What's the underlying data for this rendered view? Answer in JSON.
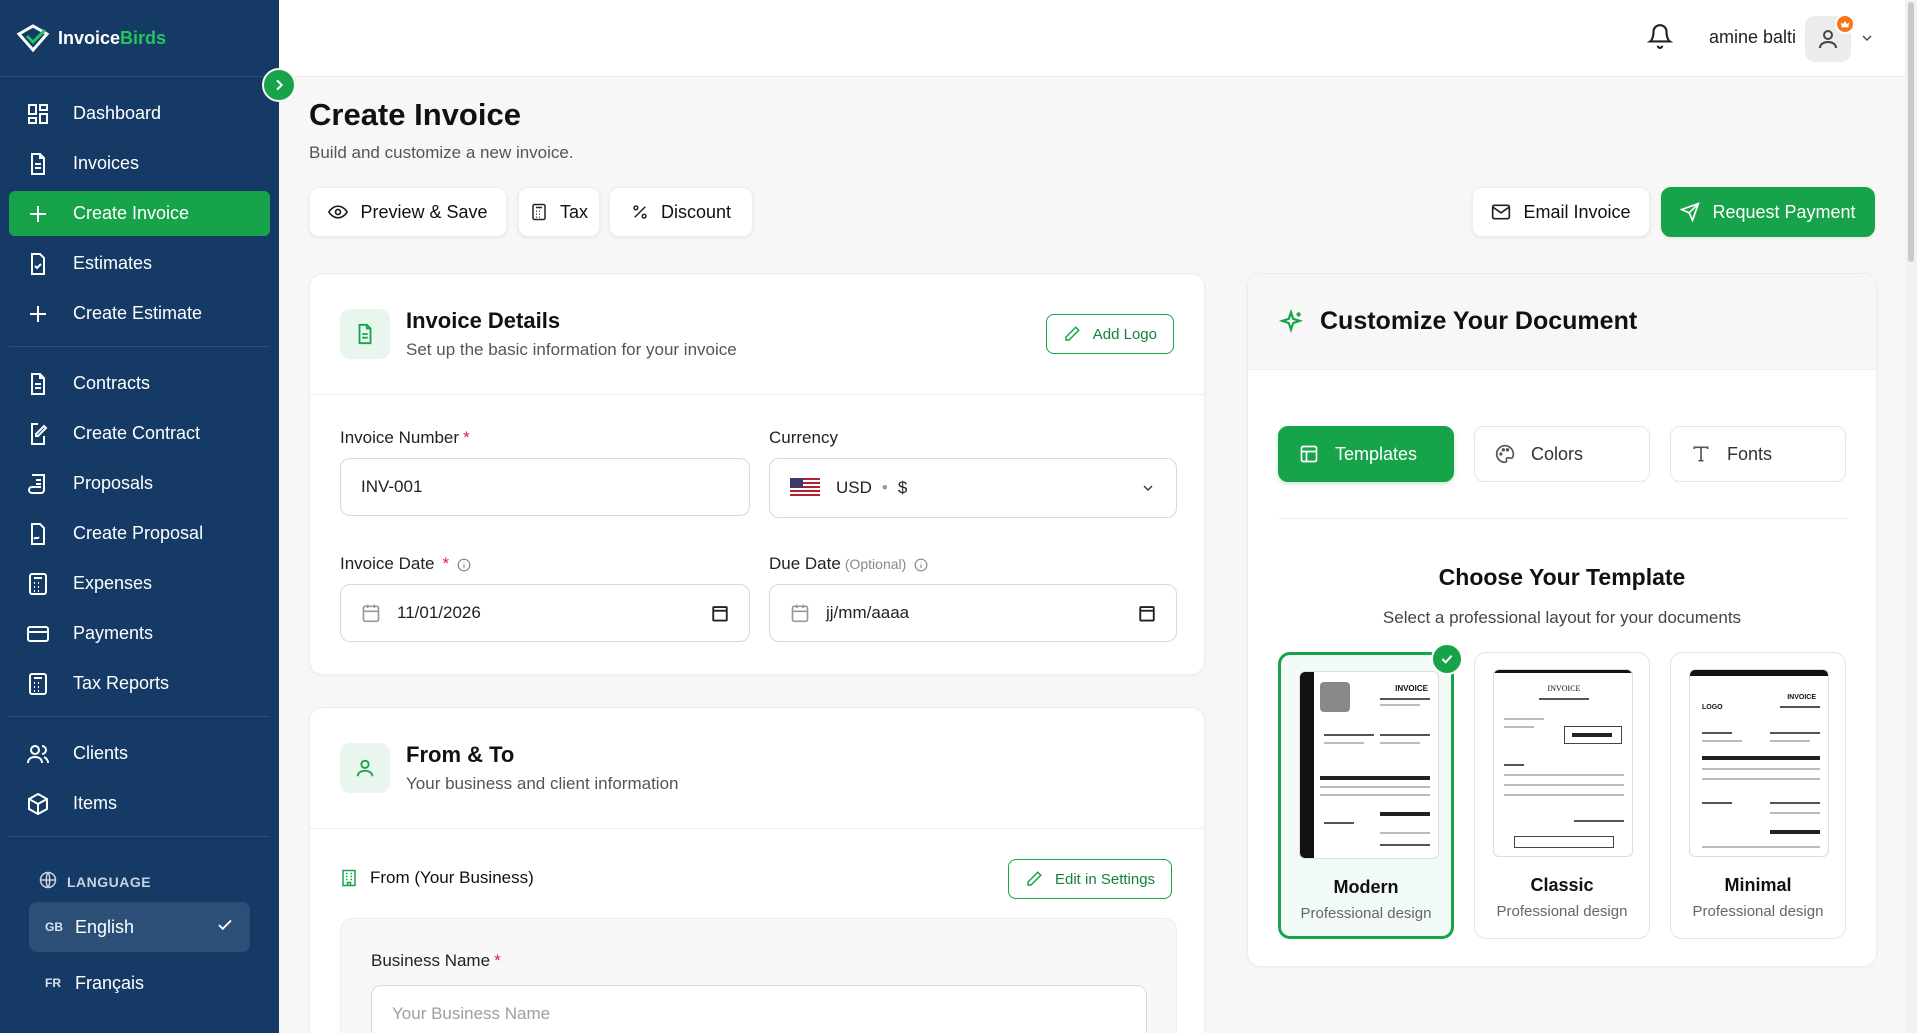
{
  "brand": {
    "name_part1": "Invoice",
    "name_part2": "Birds"
  },
  "sidebar": {
    "items": [
      {
        "label": "Dashboard",
        "icon": "dashboard-icon"
      },
      {
        "label": "Invoices",
        "icon": "document-icon"
      },
      {
        "label": "Create Invoice",
        "icon": "plus-icon",
        "active": true
      },
      {
        "label": "Estimates",
        "icon": "clipboard-check-icon"
      },
      {
        "label": "Create Estimate",
        "icon": "plus-icon"
      },
      {
        "label": "Contracts",
        "icon": "document-icon"
      },
      {
        "label": "Create Contract",
        "icon": "file-edit-icon"
      },
      {
        "label": "Proposals",
        "icon": "scroll-icon"
      },
      {
        "label": "Create Proposal",
        "icon": "file-signature-icon"
      },
      {
        "label": "Expenses",
        "icon": "calculator-icon"
      },
      {
        "label": "Payments",
        "icon": "credit-card-icon"
      },
      {
        "label": "Tax Reports",
        "icon": "calculator-icon"
      },
      {
        "label": "Clients",
        "icon": "users-icon"
      },
      {
        "label": "Items",
        "icon": "box-icon"
      }
    ],
    "language": {
      "title": "LANGUAGE",
      "options": [
        {
          "code": "GB",
          "label": "English",
          "selected": true
        },
        {
          "code": "FR",
          "label": "Français",
          "selected": false
        }
      ]
    }
  },
  "topbar": {
    "username": "amine balti"
  },
  "page": {
    "title": "Create Invoice",
    "subtitle": "Build and customize a new invoice."
  },
  "toolbar": {
    "preview_save": "Preview & Save",
    "tax": "Tax",
    "discount": "Discount",
    "email_invoice": "Email Invoice",
    "request_payment": "Request Payment"
  },
  "invoice_details": {
    "title": "Invoice Details",
    "subtitle": "Set up the basic information for your invoice",
    "add_logo": "Add Logo",
    "invoice_number_label": "Invoice Number",
    "invoice_number_value": "INV-001",
    "currency_label": "Currency",
    "currency_code": "USD",
    "currency_sep": "•",
    "currency_symbol": "$",
    "invoice_date_label": "Invoice Date",
    "invoice_date_value": "11/01/2026",
    "due_date_label": "Due Date",
    "due_date_optional": "(Optional)",
    "due_date_placeholder": "jj/mm/aaaa",
    "required_mark": "*"
  },
  "from_to": {
    "title": "From & To",
    "subtitle": "Your business and client information",
    "from_label": "From (Your Business)",
    "edit_settings": "Edit in Settings",
    "business_name_label": "Business Name",
    "business_name_placeholder": "Your Business Name"
  },
  "customize": {
    "title": "Customize Your Document",
    "tabs": [
      "Templates",
      "Colors",
      "Fonts"
    ],
    "choose_title": "Choose Your Template",
    "choose_subtitle": "Select a professional layout for your documents",
    "templates": [
      {
        "name": "Modern",
        "desc": "Professional design",
        "selected": true,
        "preview_label": "INVOICE"
      },
      {
        "name": "Classic",
        "desc": "Professional design",
        "selected": false,
        "preview_label": "INVOICE"
      },
      {
        "name": "Minimal",
        "desc": "Professional design",
        "selected": false,
        "preview_label": "INVOICE",
        "logo_label": "LOGO"
      }
    ]
  },
  "colors": {
    "accent": "#16a34a",
    "sidebar": "#153a66"
  }
}
